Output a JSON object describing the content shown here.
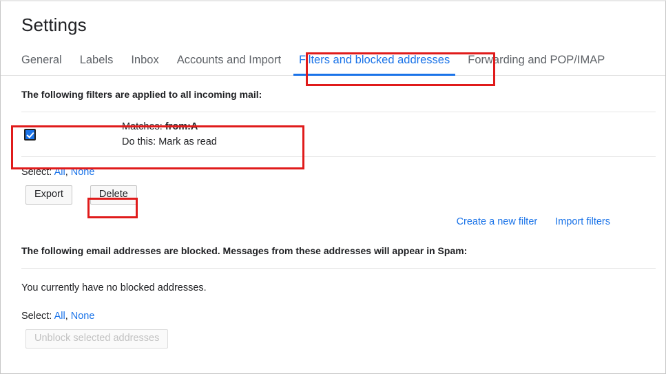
{
  "header": {
    "title": "Settings"
  },
  "tabs": [
    {
      "label": "General",
      "active": false
    },
    {
      "label": "Labels",
      "active": false
    },
    {
      "label": "Inbox",
      "active": false
    },
    {
      "label": "Accounts and Import",
      "active": false
    },
    {
      "label": "Filters and blocked addresses",
      "active": true
    },
    {
      "label": "Forwarding and POP/IMAP",
      "active": false
    }
  ],
  "filters_section": {
    "heading": "The following filters are applied to all incoming mail:",
    "rows": [
      {
        "checked": true,
        "matches_label": "Matches:",
        "matches_value": "from:A",
        "action_label": "Do this:",
        "action_value": "Mark as read"
      }
    ],
    "select_label": "Select:",
    "select_all": "All",
    "select_separator": ",",
    "select_none": "None",
    "export_button": "Export",
    "delete_button": "Delete",
    "create_filter_link": "Create a new filter",
    "import_filters_link": "Import filters"
  },
  "blocked_section": {
    "heading": "The following email addresses are blocked. Messages from these addresses will appear in Spam:",
    "empty_message": "You currently have no blocked addresses.",
    "select_label": "Select:",
    "select_all": "All",
    "select_separator": ",",
    "select_none": "None",
    "unblock_button": "Unblock selected addresses"
  },
  "colors": {
    "accent_blue": "#1a73e8",
    "annotation_red": "#e01b1b",
    "text_primary": "#202124",
    "text_secondary": "#5f6368"
  }
}
